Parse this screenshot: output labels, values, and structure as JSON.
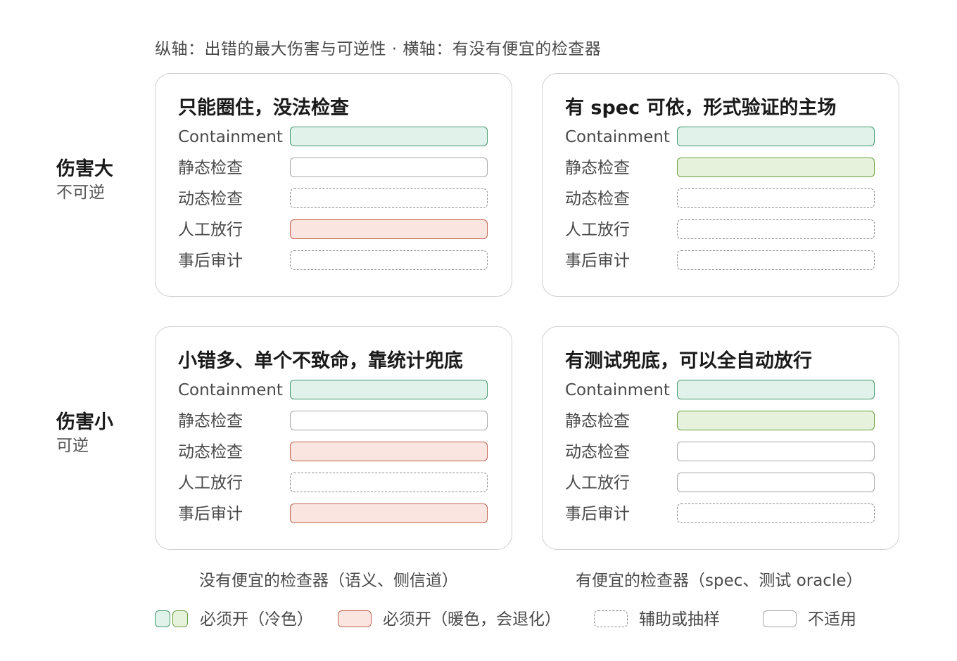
{
  "caption": "纵轴：出错的最大伤害与可逆性 · 横轴：有没有便宜的检查器",
  "rows": [
    {
      "main": "伤害大",
      "sub": "不可逆"
    },
    {
      "main": "伤害小",
      "sub": "可逆"
    }
  ],
  "panels": [
    {
      "title": "只能圈住，没法检查",
      "items": [
        {
          "label": "Containment",
          "status": "必须开（冷色）"
        },
        {
          "label": "静态检查",
          "status": "不适用"
        },
        {
          "label": "动态检查",
          "status": "辅助或抽样"
        },
        {
          "label": "人工放行",
          "status": "必须开（暖色，会退化）"
        },
        {
          "label": "事后审计",
          "status": "辅助或抽样"
        }
      ]
    },
    {
      "title": "有 spec 可依，形式验证的主场",
      "items": [
        {
          "label": "Containment",
          "status": "必须开（冷色）"
        },
        {
          "label": "静态检查",
          "status": "必须开（冷色）"
        },
        {
          "label": "动态检查",
          "status": "辅助或抽样"
        },
        {
          "label": "人工放行",
          "status": "辅助或抽样"
        },
        {
          "label": "事后审计",
          "status": "辅助或抽样"
        }
      ]
    },
    {
      "title": "小错多、单个不致命，靠统计兜底",
      "items": [
        {
          "label": "Containment",
          "status": "必须开（冷色）"
        },
        {
          "label": "静态检查",
          "status": "不适用"
        },
        {
          "label": "动态检查",
          "status": "必须开（暖色，会退化）"
        },
        {
          "label": "人工放行",
          "status": "辅助或抽样"
        },
        {
          "label": "事后审计",
          "status": "必须开（暖色，会退化）"
        }
      ]
    },
    {
      "title": "有测试兜底，可以全自动放行",
      "items": [
        {
          "label": "Containment",
          "status": "必须开（冷色）"
        },
        {
          "label": "静态检查",
          "status": "必须开（冷色）"
        },
        {
          "label": "动态检查",
          "status": "不适用"
        },
        {
          "label": "人工放行",
          "status": "不适用"
        },
        {
          "label": "事后审计",
          "status": "辅助或抽样"
        }
      ]
    }
  ],
  "x_labels": [
    "没有便宜的检查器（语义、侧信道）",
    "有便宜的检查器（spec、测试 oracle）"
  ],
  "legend": [
    {
      "label": "必须开（冷色）"
    },
    {
      "label": "必须开（暖色，会退化）"
    },
    {
      "label": "辅助或抽样"
    },
    {
      "label": "不适用"
    }
  ],
  "colors": {
    "cool_teal_fill": "#e1f2ea",
    "cool_teal_border": "#3f9a6e",
    "cool_green_fill": "#e7f2dd",
    "cool_green_border": "#6b9e3c",
    "warm_fill": "#fae5e1",
    "warm_border": "#c0624e",
    "dashed_border": "#8a8a8a",
    "na_border": "#a6a6a6"
  }
}
